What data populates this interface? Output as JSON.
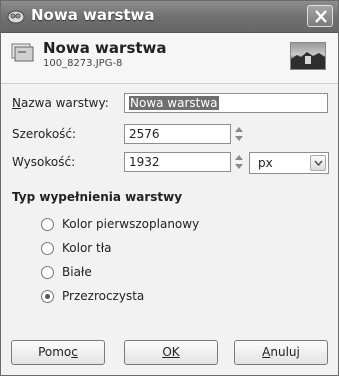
{
  "window": {
    "title": "Nowa warstwa"
  },
  "header": {
    "title": "Nowa warstwa",
    "subtitle": "100_8273.JPG-8"
  },
  "form": {
    "name_label": "Nazwa warstwy:",
    "name_value": "Nowa warstwa",
    "width_label": "Szerokość:",
    "width_value": "2576",
    "height_label": "Wysokość:",
    "height_value": "1932",
    "unit_value": "px"
  },
  "fill": {
    "section_title": "Typ wypełnienia warstwy",
    "options": [
      {
        "label": "Kolor pierwszoplanowy",
        "selected": false
      },
      {
        "label": "Kolor tła",
        "selected": false
      },
      {
        "label": "Białe",
        "selected": false
      },
      {
        "label": "Przezroczysta",
        "selected": true
      }
    ]
  },
  "buttons": {
    "help": "Pomoc",
    "ok": "OK",
    "cancel": "Anuluj"
  }
}
